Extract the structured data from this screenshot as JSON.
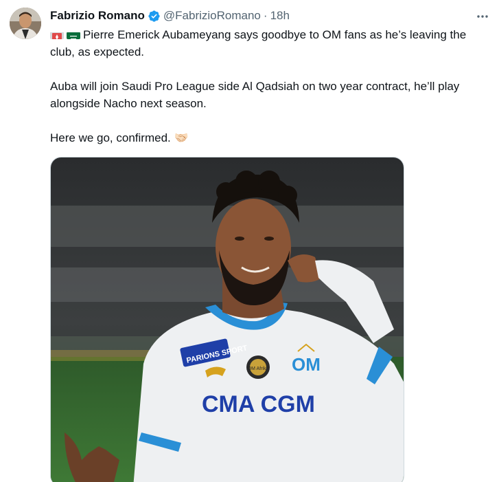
{
  "tweet": {
    "author": {
      "display_name": "Fabrizio Romano",
      "handle": "@FabrizioRomano",
      "verified": true,
      "verified_color": "#1d9bf0"
    },
    "separator": "·",
    "timestamp": "18h",
    "flags": [
      "flag-monaco-icon",
      "flag-saudi-arabia-icon"
    ],
    "text": {
      "line1": "Pierre Emerick Aubameyang says goodbye to OM fans as he’s leaving the club, as expected.",
      "line2": "Auba will join Saudi Pro League side Al Qadsiah on two year contract, he’ll play alongside Nacho next season.",
      "line3": "Here we go, confirmed. 🤝🏻"
    },
    "media": {
      "jersey_sponsor": "CMA CGM",
      "jersey_badge_text": "PARIONS SPORT",
      "club_crest_text": "OM",
      "patch_text": "OM Afrika"
    }
  },
  "colors": {
    "text_primary": "#0f1419",
    "text_secondary": "#536471",
    "accent": "#1d9bf0"
  }
}
